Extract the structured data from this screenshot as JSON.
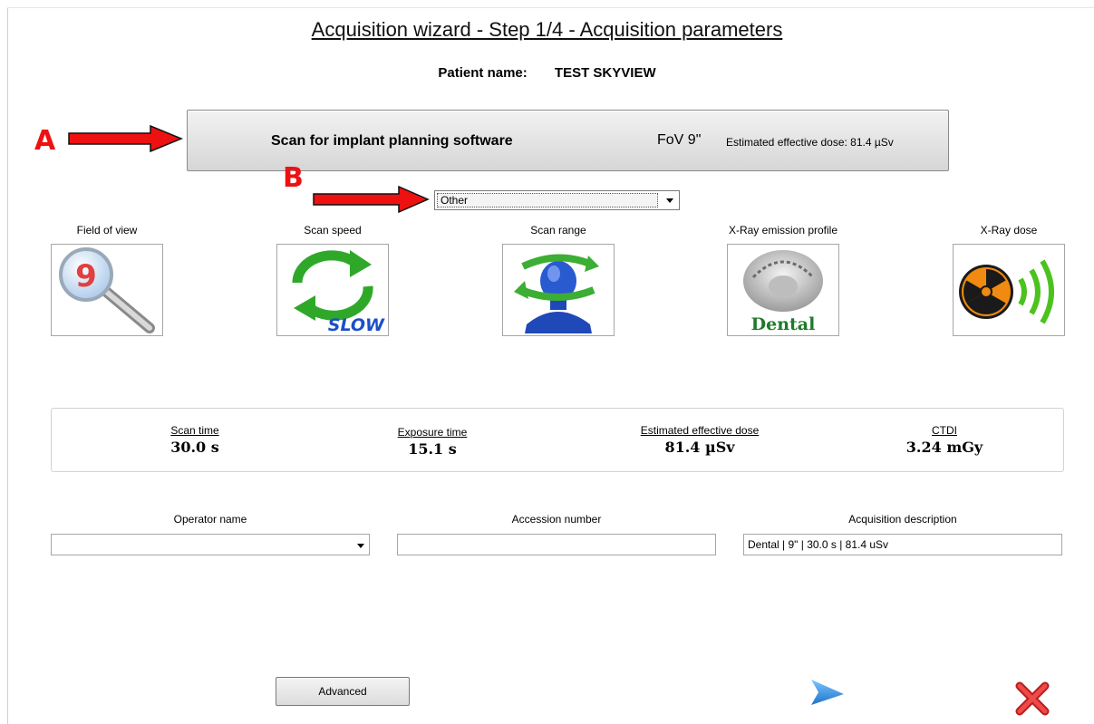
{
  "window": {
    "title": "Acquisition wizard - Step 1/4 - Acquisition parameters"
  },
  "patient": {
    "label": "Patient name:",
    "value": "TEST SKYVIEW"
  },
  "scan_button": {
    "name": "Scan for implant planning software",
    "fov": "FoV 9\"",
    "dose": "Estimated effective dose: 81.4 µSv"
  },
  "annotations": {
    "a": "A",
    "b": "B",
    "arrow_color": "#ee1111"
  },
  "profile_select": {
    "value": "Other"
  },
  "params": [
    {
      "label": "Field of view",
      "icon": "magnifier-9-icon",
      "number": "9"
    },
    {
      "label": "Scan speed",
      "icon": "refresh-arrows-icon",
      "caption": "SLOW"
    },
    {
      "label": "Scan range",
      "icon": "head-rotation-icon"
    },
    {
      "label": "X-Ray emission profile",
      "icon": "dental-arch-icon",
      "caption": "Dental"
    },
    {
      "label": "X-Ray dose",
      "icon": "radiation-icon"
    }
  ],
  "summary": {
    "scan_time": {
      "label": "Scan time",
      "value": "30.0 s"
    },
    "exposure_time": {
      "label": "Exposure time",
      "value": "15.1 s"
    },
    "effective_dose": {
      "label": "Estimated effective dose",
      "value": "81.4 µSv"
    },
    "ctdi": {
      "label": "CTDI",
      "value": "3.24 mGy"
    }
  },
  "fields": {
    "operator": {
      "label": "Operator name",
      "value": ""
    },
    "accession": {
      "label": "Accession number",
      "value": ""
    },
    "description": {
      "label": "Acquisition description",
      "value": "Dental | 9\" | 30.0 s | 81.4 uSv"
    }
  },
  "buttons": {
    "advanced": "Advanced",
    "next_icon": "next-arrow-icon",
    "close_icon": "close-x-icon"
  },
  "colors": {
    "annotation_red": "#ee1111",
    "next_blue": "#2e8fe0",
    "close_red": "#e53030",
    "radiation_orange": "#f08a10",
    "wave_green": "#4cc21e"
  }
}
